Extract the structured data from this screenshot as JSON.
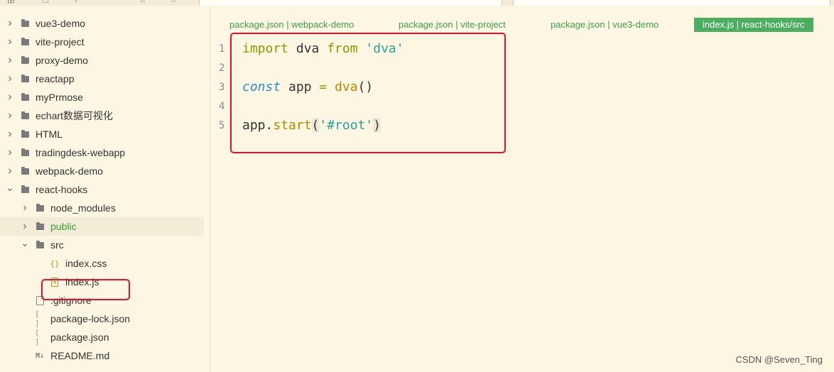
{
  "sidebar": {
    "items": [
      {
        "label": "vue3-demo",
        "type": "folder",
        "expanded": false,
        "level": 0
      },
      {
        "label": "vite-project",
        "type": "folder",
        "expanded": false,
        "level": 0
      },
      {
        "label": "proxy-demo",
        "type": "folder",
        "expanded": false,
        "level": 0
      },
      {
        "label": "reactapp",
        "type": "folder",
        "expanded": false,
        "level": 0
      },
      {
        "label": "myPrmose",
        "type": "folder",
        "expanded": false,
        "level": 0
      },
      {
        "label": "echart数据可视化",
        "type": "folder",
        "expanded": false,
        "level": 0
      },
      {
        "label": "HTML",
        "type": "folder",
        "expanded": false,
        "level": 0
      },
      {
        "label": "tradingdesk-webapp",
        "type": "folder",
        "expanded": false,
        "level": 0
      },
      {
        "label": "webpack-demo",
        "type": "folder",
        "expanded": false,
        "level": 0
      },
      {
        "label": "react-hooks",
        "type": "folder",
        "expanded": true,
        "level": 0
      },
      {
        "label": "node_modules",
        "type": "folder",
        "expanded": false,
        "level": 1
      },
      {
        "label": "public",
        "type": "folder",
        "expanded": false,
        "level": 1
      },
      {
        "label": "src",
        "type": "folder",
        "expanded": true,
        "level": 1
      },
      {
        "label": "index.css",
        "type": "css",
        "level": 2
      },
      {
        "label": "index.js",
        "type": "js",
        "level": 2
      },
      {
        "label": ".gitignore",
        "type": "file",
        "level": 1
      },
      {
        "label": "package-lock.json",
        "type": "json",
        "level": 1
      },
      {
        "label": "package.json",
        "type": "json",
        "level": 1
      },
      {
        "label": "README.md",
        "type": "md",
        "level": 1
      }
    ]
  },
  "icons": {
    "folder": "folder-icon",
    "css": "css-file-icon",
    "js": "js-file-icon",
    "json": "json-file-icon",
    "md": "markdown-file-icon",
    "file": "file-icon",
    "css_glyph": "{}",
    "json_glyph": "[ ]",
    "md_glyph": "M↓"
  },
  "tabs": [
    {
      "label": "package.json | webpack-demo",
      "active": false
    },
    {
      "label": "package.json | vite-project",
      "active": false
    },
    {
      "label": "package.json | vue3-demo",
      "active": false
    },
    {
      "label": "index.js | react-hooks/src",
      "active": true
    }
  ],
  "editor": {
    "lines": [
      {
        "n": "1"
      },
      {
        "n": "2"
      },
      {
        "n": "3"
      },
      {
        "n": "4"
      },
      {
        "n": "5"
      }
    ],
    "code": {
      "l1_import": "import",
      "l1_dva": " dva ",
      "l1_from": "from",
      "l1_space": " ",
      "l1_str": "'dva'",
      "l3_const": "const",
      "l3_app": " app ",
      "l3_eq": "=",
      "l3_space": " ",
      "l3_fn": "dva",
      "l3_parens": "()",
      "l5_app": "app.",
      "l5_fn": "start",
      "l5_open": "(",
      "l5_str": "'#root'",
      "l5_close": ")"
    }
  },
  "watermark": "CSDN @Seven_Ting",
  "colors": {
    "background": "#fdf6e3",
    "highlight_box": "#e8102a",
    "active_tab": "#4caf60",
    "tab_text": "#3aa04a"
  }
}
